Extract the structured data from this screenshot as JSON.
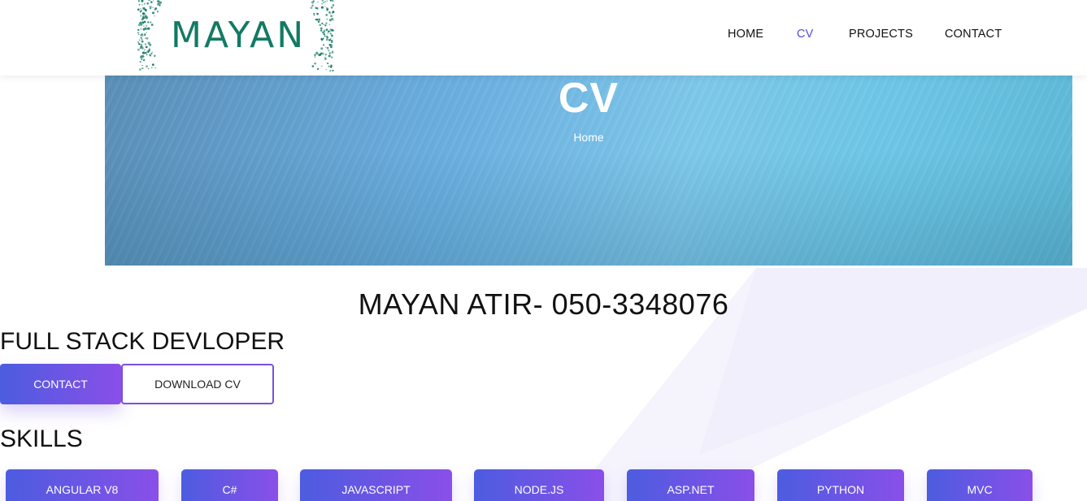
{
  "header": {
    "logo_text": "MAYAN",
    "nav": [
      {
        "label": "HOME",
        "active": false
      },
      {
        "label": "CV",
        "active": true
      },
      {
        "label": "PROJECTS",
        "active": false
      },
      {
        "label": "CONTACT",
        "active": false
      }
    ]
  },
  "hero": {
    "title": "CV",
    "breadcrumb": "Home"
  },
  "profile": {
    "name_phone": "MAYAN ATIR- 050-3348076",
    "role": "FULL STACK DEVLOPER",
    "contact_button": "CONTACT",
    "download_button": "DOWNLOAD CV"
  },
  "skills": {
    "title": "SKILLS",
    "items": [
      "ANGULAR V8",
      "C#",
      "JAVASCRIPT",
      "NODE.JS",
      "ASP.NET",
      "PYTHON",
      "MVC"
    ]
  },
  "colors": {
    "accent_start": "#4c5ce0",
    "accent_end": "#8a4fe8",
    "nav_active": "#4f4fd8",
    "logo": "#137a64"
  }
}
